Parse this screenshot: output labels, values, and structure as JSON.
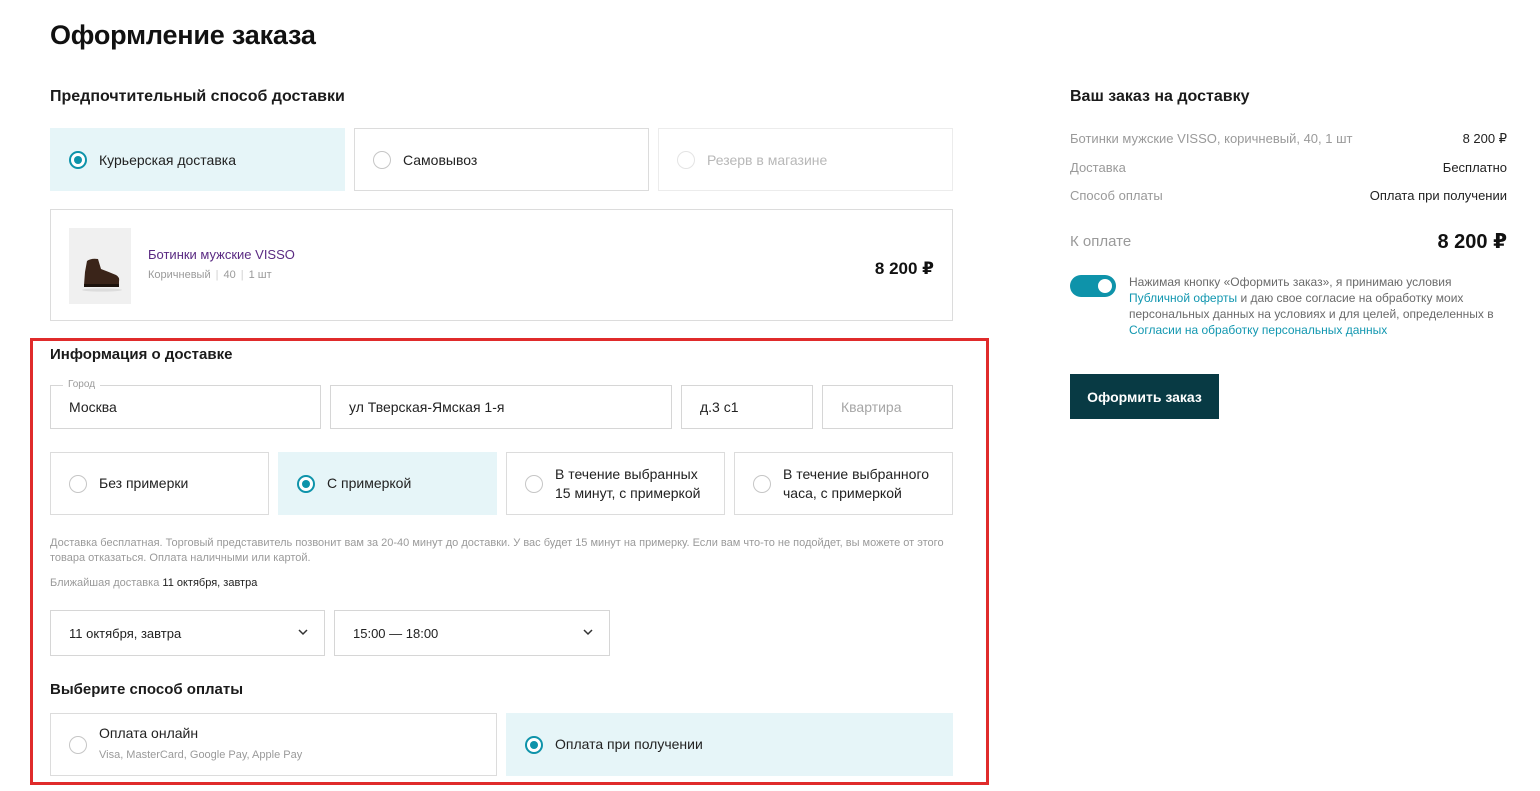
{
  "page": {
    "title": "Оформление заказа"
  },
  "delivery_method": {
    "title": "Предпочтительный способ доставки",
    "options": [
      {
        "label": "Курьерская доставка",
        "selected": true
      },
      {
        "label": "Самовывоз",
        "selected": false
      },
      {
        "label": "Резерв в магазине",
        "selected": false,
        "disabled": true
      }
    ]
  },
  "product": {
    "name": "Ботинки мужские VISSO",
    "color": "Коричневый",
    "size": "40",
    "qty": "1 шт",
    "price": "8 200 ₽"
  },
  "delivery_info": {
    "title": "Информация о доставке",
    "city_label": "Город",
    "city": "Москва",
    "street": "ул Тверская-Ямская 1-я",
    "house": "д.3 с1",
    "apartment_placeholder": "Квартира",
    "fitting_options": [
      {
        "label": "Без примерки",
        "selected": false
      },
      {
        "label": "С примеркой",
        "selected": true
      },
      {
        "label": "В течение выбранных 15 минут, с примеркой",
        "selected": false
      },
      {
        "label": "В течение выбранного часа, с примеркой",
        "selected": false
      }
    ],
    "note": "Доставка бесплатная.  Торговый представитель позвонит вам за 20-40 минут до доставки. У вас будет 15 минут на примерку. Если вам что-то не подойдет, вы можете от этого товара отказаться. Оплата наличными или картой.",
    "nearest_label": "Ближайшая доставка",
    "nearest_value": "11 октября, завтра",
    "date_select": "11 октября, завтра",
    "time_select": "15:00 — 18:00"
  },
  "payment": {
    "title": "Выберите способ оплаты",
    "options": [
      {
        "label": "Оплата онлайн",
        "sub": "Visa, MasterCard, Google Pay, Apple Pay",
        "selected": false
      },
      {
        "label": "Оплата при получении",
        "sub": "",
        "selected": true
      }
    ]
  },
  "summary": {
    "title": "Ваш заказ на доставку",
    "item_label": "Ботинки мужские VISSO, коричневый, 40, 1 шт",
    "item_price": "8 200 ₽",
    "delivery_label": "Доставка",
    "delivery_value": "Бесплатно",
    "payment_label": "Способ оплаты",
    "payment_value": "Оплата при получении",
    "total_label": "К оплате",
    "total_value": "8 200 ₽"
  },
  "consent": {
    "text_1": "Нажимая кнопку «Оформить заказ», я принимаю условия ",
    "link_1": "Публичной оферты",
    "text_2": " и даю свое согласие на обработку моих персональных данных на условиях и для целей, определенных в ",
    "link_2": "Согласии на обработку персональных данных",
    "toggle_on": true
  },
  "actions": {
    "order_button": "Оформить заказ"
  },
  "colors": {
    "accent": "#0e93aa",
    "selected_bg": "#e6f5f8",
    "button_bg": "#083a44",
    "highlight": "#e02b2b",
    "product_link": "#5a2a82"
  }
}
